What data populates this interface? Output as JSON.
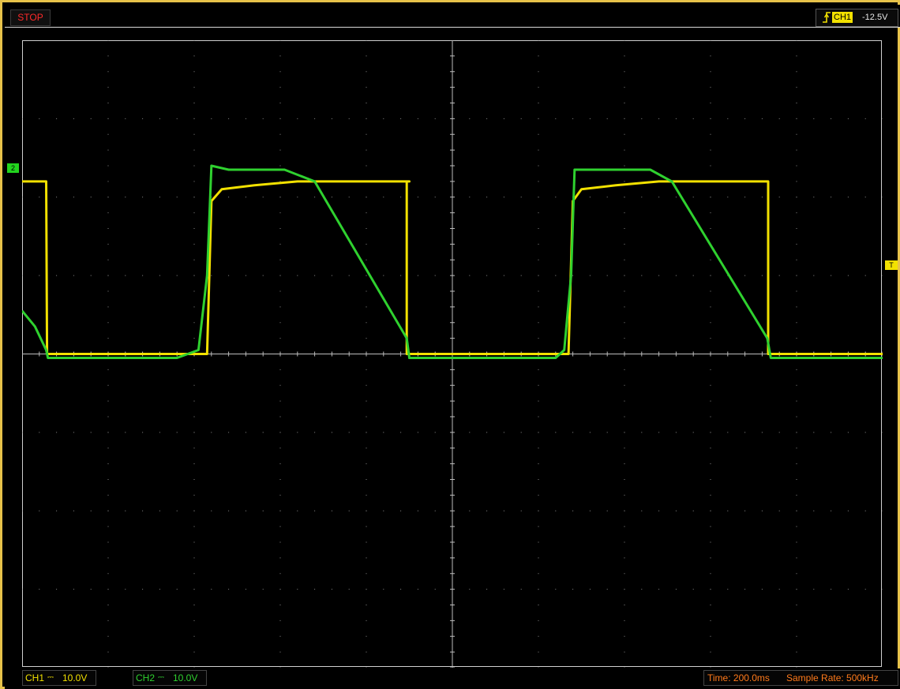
{
  "window": {
    "status": "STOP",
    "trigger": {
      "edge_icon": "rising-edge-icon",
      "channel": "CH1",
      "level": "-12.5V"
    }
  },
  "channels": [
    {
      "label": "CH1",
      "coupling": "⎓",
      "scale": "10.0V",
      "color": "#f2e100"
    },
    {
      "label": "CH2",
      "coupling": "⎓",
      "scale": "10.0V",
      "color": "#2fd12f"
    }
  ],
  "markers": {
    "ch2_ref": "2",
    "trigger_pos": "T"
  },
  "timebase": {
    "time": "Time: 200.0ms",
    "sample_rate": "Sample Rate: 500kHz"
  },
  "chart_data": {
    "type": "line",
    "grid": true,
    "xlim": [
      0,
      10
    ],
    "ylim": [
      -4,
      4
    ],
    "series": [
      {
        "name": "CH1",
        "color": "#f2e100",
        "points": [
          [
            0,
            2.2
          ],
          [
            0.28,
            2.2
          ],
          [
            0.29,
            0
          ],
          [
            2.05,
            0
          ],
          [
            2.15,
            0
          ],
          [
            2.2,
            1.95
          ],
          [
            2.32,
            2.1
          ],
          [
            2.7,
            2.15
          ],
          [
            3.2,
            2.2
          ],
          [
            4.5,
            2.2
          ],
          [
            4.47,
            2.2
          ],
          [
            4.47,
            0
          ],
          [
            6.2,
            0
          ],
          [
            6.35,
            0
          ],
          [
            6.4,
            1.95
          ],
          [
            6.5,
            2.1
          ],
          [
            6.9,
            2.15
          ],
          [
            7.4,
            2.2
          ],
          [
            8.67,
            2.2
          ],
          [
            8.67,
            0
          ],
          [
            10,
            0
          ]
        ]
      },
      {
        "name": "CH2",
        "color": "#2fd12f",
        "points": [
          [
            0,
            0.55
          ],
          [
            0.15,
            0.35
          ],
          [
            0.28,
            0.05
          ],
          [
            0.3,
            -0.05
          ],
          [
            1.8,
            -0.05
          ],
          [
            2.05,
            0.05
          ],
          [
            2.15,
            1.0
          ],
          [
            2.2,
            2.4
          ],
          [
            2.4,
            2.35
          ],
          [
            3.05,
            2.35
          ],
          [
            3.4,
            2.2
          ],
          [
            4.47,
            0.2
          ],
          [
            4.5,
            -0.05
          ],
          [
            6.2,
            -0.05
          ],
          [
            6.3,
            0.05
          ],
          [
            6.38,
            1.0
          ],
          [
            6.42,
            2.35
          ],
          [
            7.3,
            2.35
          ],
          [
            7.55,
            2.2
          ],
          [
            8.66,
            0.2
          ],
          [
            8.7,
            -0.05
          ],
          [
            10,
            -0.05
          ]
        ]
      }
    ]
  }
}
